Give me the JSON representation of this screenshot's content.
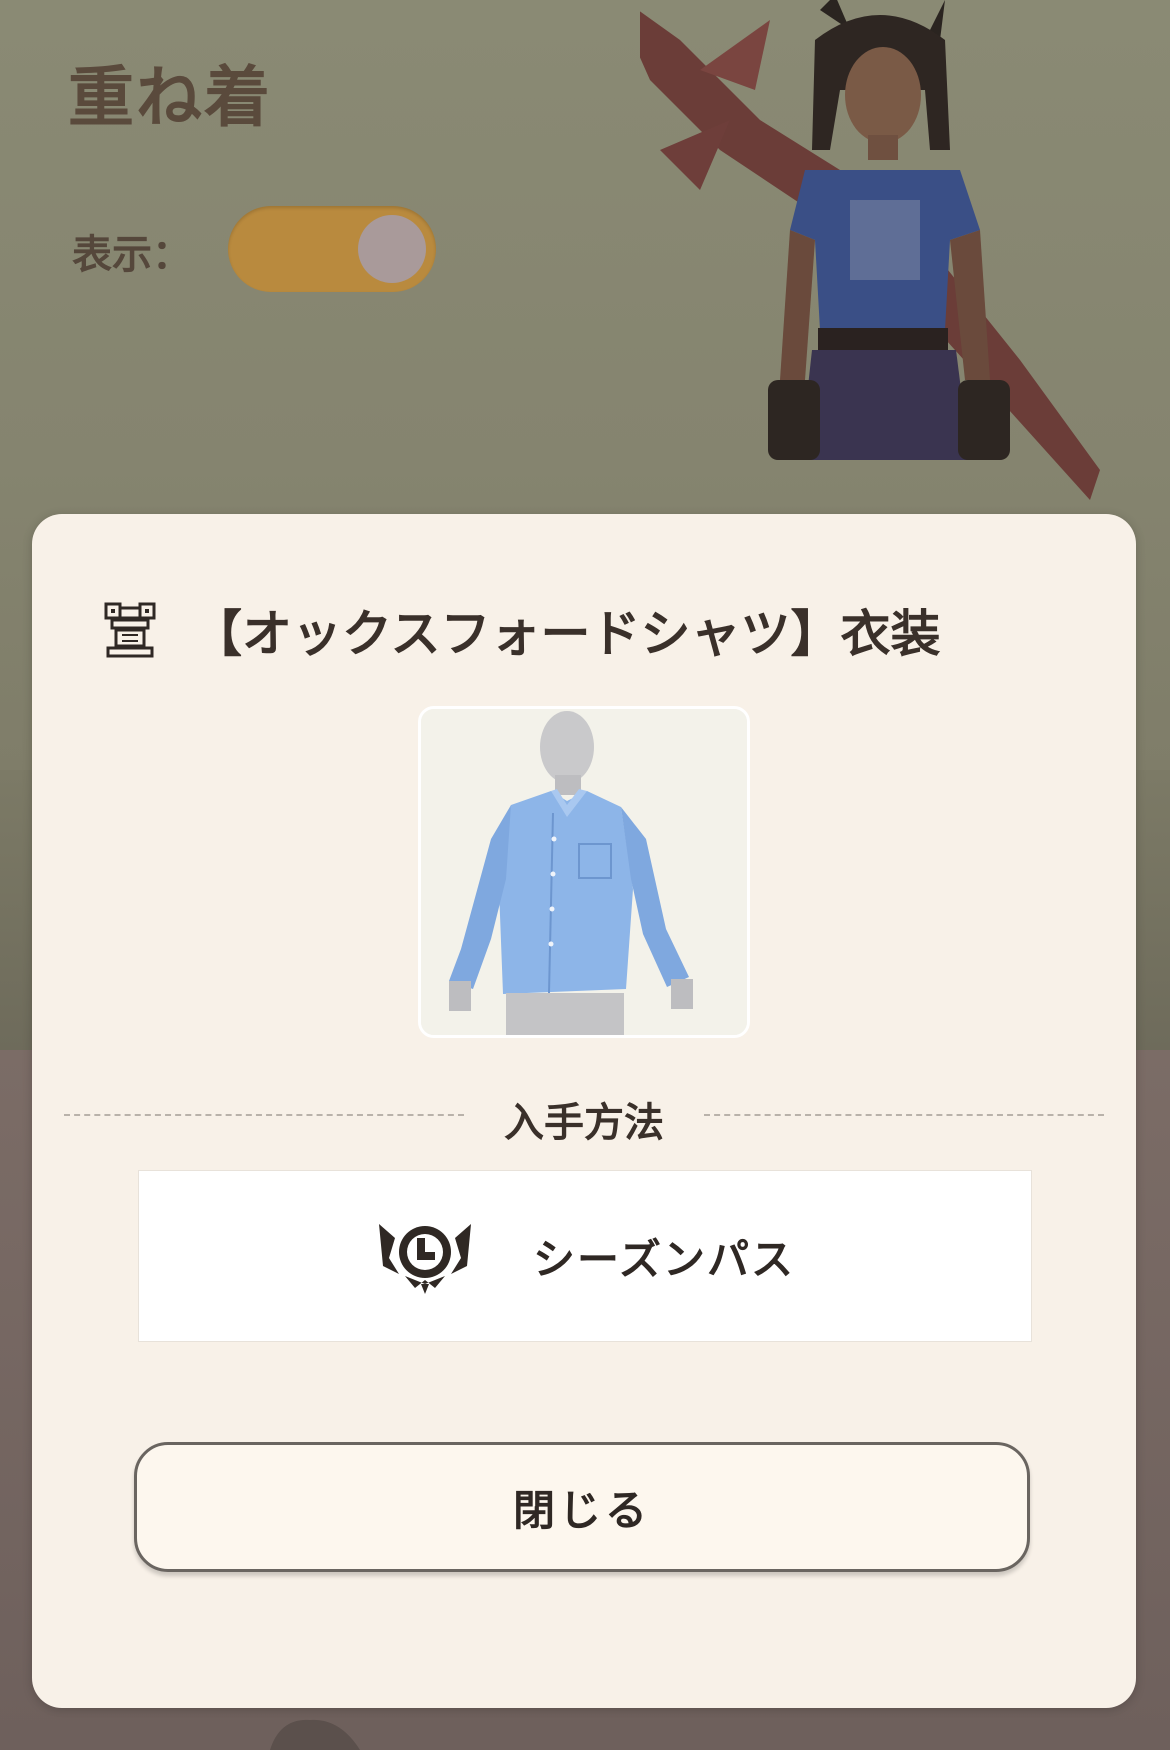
{
  "background": {
    "title": "重ね着",
    "display_label": "表示：",
    "display_toggle_on": true
  },
  "modal": {
    "title": "【オックスフォードシャツ】衣装",
    "item_icon": "armor-chest-icon",
    "preview_image": "oxford-shirt-preview",
    "acquisition_heading": "入手方法",
    "acquisition_method": {
      "icon": "season-pass-icon",
      "label": "シーズンパス"
    },
    "close_label": "閉じる"
  },
  "colors": {
    "modal_background": "#f8f1e8",
    "toggle_on": "#b98a3e",
    "text_dark": "#3a302a",
    "title_brown": "#5a4a3c"
  }
}
